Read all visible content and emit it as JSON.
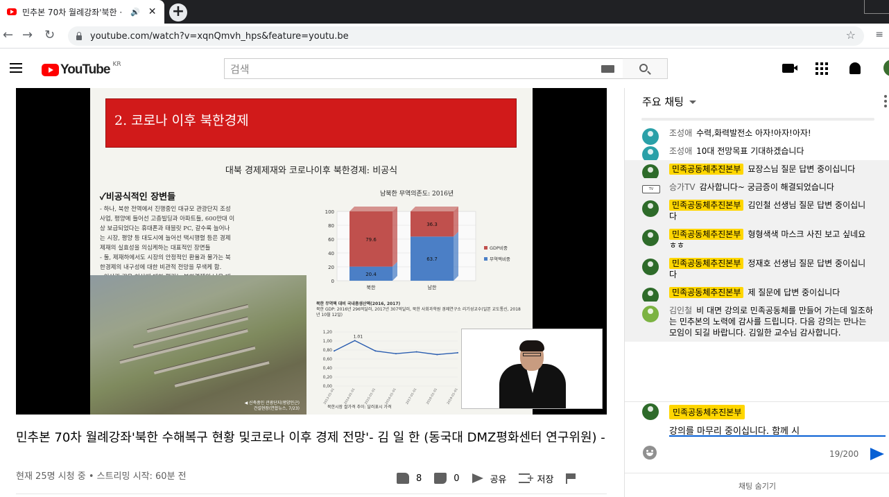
{
  "browser": {
    "tab_title": "민추본 70차 월례강좌'북한 ·",
    "url": "youtube.com/watch?v=xqnQmvh_hps&feature=youtu.be"
  },
  "header": {
    "logo_text": "YouTube",
    "region": "KR",
    "search_placeholder": "검색"
  },
  "slide": {
    "banner_title": "2. 코로나 이후 북한경제",
    "subtitle": "대북 경제제재와 코로나이후 북한경제: 비공식",
    "section_heading": "✓비공식적인 장변들",
    "body_text": "- 하나, 북한 전역에서 진행중인 대규모 관광단지 조성\n사업, 평양에 들어선 고층빌딩과 아파트들, 600만대 이\n상 보급되었다는 휴대폰과 태블릿 PC, 갈수록 늘어나\n는 시장, 평양 등 대도시에 늘어선 택시행렬 등은 경제\n제재의 실효성을 의심케하는 대표적인 장면들\n- 둘, 제재하에서도 시장의 안정적인 환율과 물가는 북\n한경제의 내구성에 대한 비관적 전망을 무색케 함.\n- 이상과 같은 현상에 대한 평가는 북한경제의 낮은 대\n외의존도, 확대되고 있는 시장의 역할, 기상이변에도 불\n구하고 비교적 생산량이 유지되는 곡물생산량, 재재의\n틈새를 활용하는 밀수 등의 낮은 수준이었던 2000년대\n부터 꾸준히 성장하고 있는 북한경제의 내구성을 유지하\n는 원인으로 분석 가능",
    "photo_caption": "◀ 신축중인 관광단지(평양인근)\n건설현장(연합뉴스, 7/23)",
    "chart_title": "남북한 무역의존도: 2016년",
    "source_title": "북한 무역액 대비 국내총생산액(2016, 2017)",
    "source_text": "북한 GDP: 2016년 296억달러, 2017년 307억달러, 북한 사회과학원 경제연구소 리기성교수(일본 교도통신, 2018년 10월 12일)",
    "line_chart_caption": "북한시장 쌀가격 추이: 달러표시 가격"
  },
  "chart_data": [
    {
      "type": "bar",
      "title": "남북한 무역의존도: 2016년",
      "categories": [
        "북한",
        "남한"
      ],
      "series": [
        {
          "name": "무역액비중",
          "values": [
            20.4,
            63.7
          ],
          "color": "#4b7fc6"
        },
        {
          "name": "GDP비중",
          "values": [
            79.6,
            36.3
          ],
          "color": "#c0504d"
        }
      ],
      "stacked": true,
      "ylim": [
        0,
        100
      ],
      "yticks": [
        0,
        20,
        40,
        60,
        80,
        100
      ]
    },
    {
      "type": "line",
      "title": "",
      "ylim": [
        0,
        1.2
      ],
      "yticks": [
        "0,00",
        "0,20",
        "0,40",
        "0,60",
        "0,80",
        "1,00",
        "1,20"
      ],
      "x": [
        "2013-01-01",
        "2014-01-01",
        "2015-01-01",
        "2016-01-01",
        "2017-01-01",
        "2018-01-01",
        "2019-01-01"
      ],
      "values": [
        0.78,
        1.01,
        0.78,
        0.72,
        0.76,
        0.7,
        0.74
      ],
      "peak_label": "1.01",
      "color": "#2a5db0"
    }
  ],
  "video": {
    "title": "민추본 70차 월례강좌'북한 수해복구 현황 및코로나 이후 경제 전망'- 김 일 한 (동국대 DMZ평화센터 연구위원) -",
    "meta": "현재 25명 시청 중 • 스트리밍 시작: 60분 전",
    "likes": "8",
    "dislikes": "0",
    "share_label": "공유",
    "save_label": "저장"
  },
  "chat": {
    "mode": "주요 채팅",
    "messages": [
      {
        "author": "조성애",
        "text": "수력,화력발전소 아자!아자!아자!",
        "avatar": "teal",
        "badge": false
      },
      {
        "author": "조성애",
        "text": "10대 전망목표 기대하겠습니다",
        "avatar": "teal",
        "badge": false
      },
      {
        "author": "민족공동체추진본부",
        "text": "묘장스님 질문 답변 중이십니다",
        "avatar": "green",
        "badge": true
      },
      {
        "author": "승가TV",
        "text": "감사합니다~ 궁금증이 해결되었습니다",
        "avatar": "tv",
        "badge": false
      },
      {
        "author": "민족공동체추진본부",
        "text": "김인철 선생님 질문 답변 중이십니다",
        "avatar": "green",
        "badge": true
      },
      {
        "author": "민족공동체추진본부",
        "text": "형형색색 마스크 사진 보고 싶네요 ㅎㅎ",
        "avatar": "green",
        "badge": true
      },
      {
        "author": "민족공동체추진본부",
        "text": "정재호 선생님 질문 답변 중이십니다",
        "avatar": "green",
        "badge": true
      },
      {
        "author": "민족공동체추진본부",
        "text": "제 질문에 답변 중이십니다",
        "avatar": "green",
        "badge": true
      },
      {
        "author": "김인철",
        "text": "비 대면 강의로 민족공동체를 만들어 가는데 일조하는 민추본의 노력에 감사를 드립니다. 다음 강의는 만나는 모임이 되길 바랍니다. 김일한 교수님 감사합니다.",
        "avatar": "lgreen",
        "badge": false
      }
    ],
    "input_author": "민족공동체추진본부",
    "input_value": "강의를 마무리 중이십니다. 함께 시",
    "char_count": "19/200",
    "hide_label": "채팅 숨기기"
  }
}
